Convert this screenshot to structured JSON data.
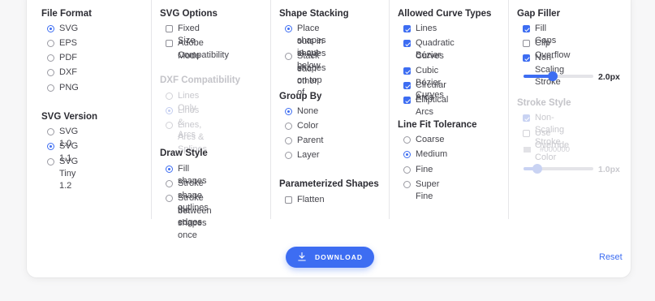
{
  "file_format": {
    "title": "File Format",
    "options": [
      {
        "label": "SVG",
        "checked": true
      },
      {
        "label": "EPS",
        "checked": false
      },
      {
        "label": "PDF",
        "checked": false
      },
      {
        "label": "DXF",
        "checked": false
      },
      {
        "label": "PNG",
        "checked": false
      }
    ]
  },
  "svg_version": {
    "title": "SVG Version",
    "options": [
      {
        "label": "SVG 1.0",
        "checked": false
      },
      {
        "label": "SVG 1.1",
        "checked": true
      },
      {
        "label": "SVG Tiny 1.2",
        "checked": false
      }
    ]
  },
  "svg_options": {
    "title": "SVG Options",
    "options": [
      {
        "label": "Fixed Size",
        "checked": false
      },
      {
        "label": "Adobe Compatibility",
        "label2": "Mode",
        "checked": false
      }
    ]
  },
  "dxf_compat": {
    "title": "DXF Compatibility",
    "disabled": true,
    "options": [
      {
        "label": "Lines Only",
        "checked": false
      },
      {
        "label": "Lines & Arcs",
        "checked": true
      },
      {
        "label": "Lines, Arcs & Splines",
        "checked": false
      }
    ]
  },
  "draw_style": {
    "title": "Draw Style",
    "options": [
      {
        "label": "Fill shapes",
        "checked": true
      },
      {
        "label": "Stroke shape outlines",
        "checked": false
      },
      {
        "label": "Stroke the edges",
        "label2": "between shapes once",
        "checked": false
      }
    ]
  },
  "shape_stacking": {
    "title": "Shape Stacking",
    "options": [
      {
        "label": "Place shapes in cut-",
        "label2": "outs in shapes below",
        "checked": true
      },
      {
        "label": "Stack shapes on top of",
        "label2": "each other",
        "checked": false
      }
    ]
  },
  "group_by": {
    "title": "Group By",
    "options": [
      {
        "label": "None",
        "checked": true
      },
      {
        "label": "Color",
        "checked": false
      },
      {
        "label": "Parent",
        "checked": false
      },
      {
        "label": "Layer",
        "checked": false
      }
    ]
  },
  "parameterized": {
    "title": "Parameterized Shapes",
    "options": [
      {
        "label": "Flatten",
        "checked": false
      }
    ]
  },
  "curve_types": {
    "title": "Allowed Curve Types",
    "options": [
      {
        "label": "Lines",
        "checked": true
      },
      {
        "label": "Quadratic Bézier",
        "label2": "Curves",
        "checked": true
      },
      {
        "label": "Cubic Bézier Curves",
        "checked": true
      },
      {
        "label": "Circular Arcs",
        "checked": true
      },
      {
        "label": "Elliptical Arcs",
        "checked": true
      }
    ]
  },
  "line_fit": {
    "title": "Line Fit Tolerance",
    "options": [
      {
        "label": "Coarse",
        "checked": false
      },
      {
        "label": "Medium",
        "checked": true
      },
      {
        "label": "Fine",
        "checked": false
      },
      {
        "label": "Super Fine",
        "checked": false
      }
    ]
  },
  "gap_filler": {
    "title": "Gap Filler",
    "options": [
      {
        "label": "Fill Gaps",
        "checked": true
      },
      {
        "label": "Clip Overflow",
        "checked": false
      },
      {
        "label": "Non-Scaling Stroke",
        "checked": true
      }
    ],
    "slider_value": "2.0px",
    "slider_fraction": 0.42
  },
  "stroke_style": {
    "title": "Stroke Style",
    "disabled": true,
    "options": [
      {
        "label": "Non-Scaling Stroke",
        "checked": true
      },
      {
        "label": "Use Override Color",
        "checked": false
      }
    ],
    "color_hex": "#000000",
    "slider_value": "1.0px",
    "slider_fraction": 0.2
  },
  "actions": {
    "download_label": "DOWNLOAD",
    "reset_label": "Reset"
  },
  "colors": {
    "accent": "#3d6df2",
    "disabled_text": "#c9c9ce"
  }
}
